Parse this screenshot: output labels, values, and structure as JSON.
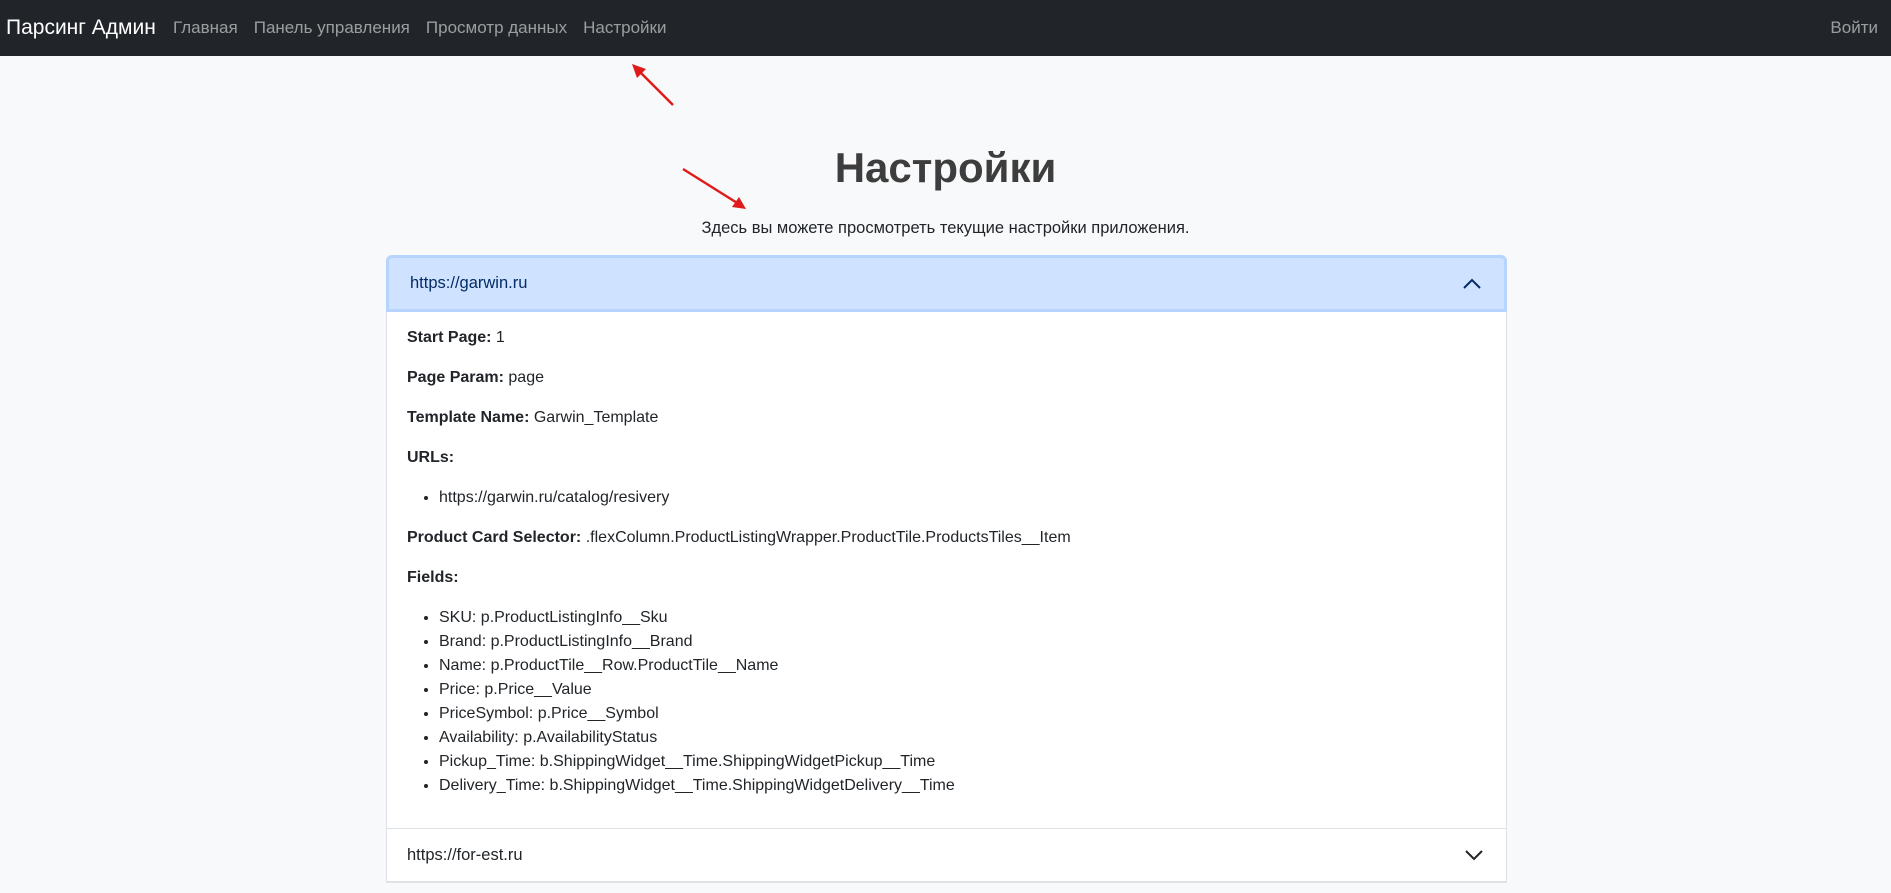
{
  "navbar": {
    "brand": "Парсинг Админ",
    "links": [
      "Главная",
      "Панель управления",
      "Просмотр данных",
      "Настройки"
    ],
    "login": "Войти"
  },
  "page": {
    "title": "Настройки",
    "subtitle": "Здесь вы можете просмотреть текущие настройки приложения."
  },
  "sites": [
    {
      "url": "https://garwin.ru",
      "expanded": true,
      "start_page_label": "Start Page:",
      "start_page": "1",
      "page_param_label": "Page Param:",
      "page_param": "page",
      "template_label": "Template Name:",
      "template": "Garwin_Template",
      "urls_label": "URLs:",
      "urls": [
        "https://garwin.ru/catalog/resivery"
      ],
      "selector_label": "Product Card Selector:",
      "selector": ".flexColumn.ProductListingWrapper.ProductTile.ProductsTiles__Item",
      "fields_label": "Fields:",
      "fields": [
        "SKU: p.ProductListingInfo__Sku",
        "Brand: p.ProductListingInfo__Brand",
        "Name: p.ProductTile__Row.ProductTile__Name",
        "Price: p.Price__Value",
        "PriceSymbol: p.Price__Symbol",
        "Availability: p.AvailabilityStatus",
        "Pickup_Time: b.ShippingWidget__Time.ShippingWidgetPickup__Time",
        "Delivery_Time: b.ShippingWidget__Time.ShippingWidgetDelivery__Time"
      ]
    },
    {
      "url": "https://for-est.ru",
      "expanded": false
    }
  ],
  "colors": {
    "navbar_bg": "#212529",
    "page_bg": "#f8f9fa",
    "accordion_active_bg": "#cfe2ff",
    "annotation_arrow": "#e01b1b"
  },
  "icons": {
    "expanded": "chevron-up-icon",
    "collapsed": "chevron-down-icon",
    "annotation": "red-arrow"
  }
}
